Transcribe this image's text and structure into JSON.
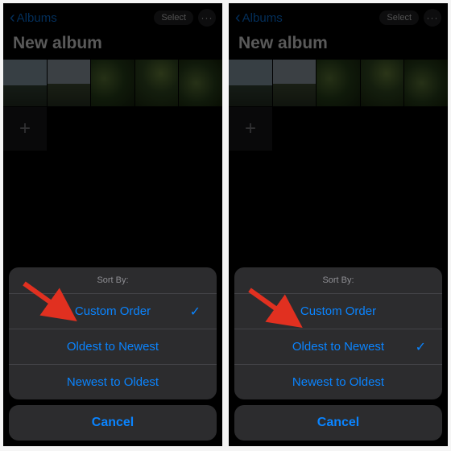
{
  "nav": {
    "back_label": "Albums",
    "select_label": "Select"
  },
  "page": {
    "title": "New album"
  },
  "sheet": {
    "header": "Sort By:",
    "options": [
      "Custom Order",
      "Oldest to Newest",
      "Newest to Oldest"
    ],
    "cancel": "Cancel"
  },
  "panels": [
    {
      "selected_index": 0
    },
    {
      "selected_index": 1
    }
  ]
}
